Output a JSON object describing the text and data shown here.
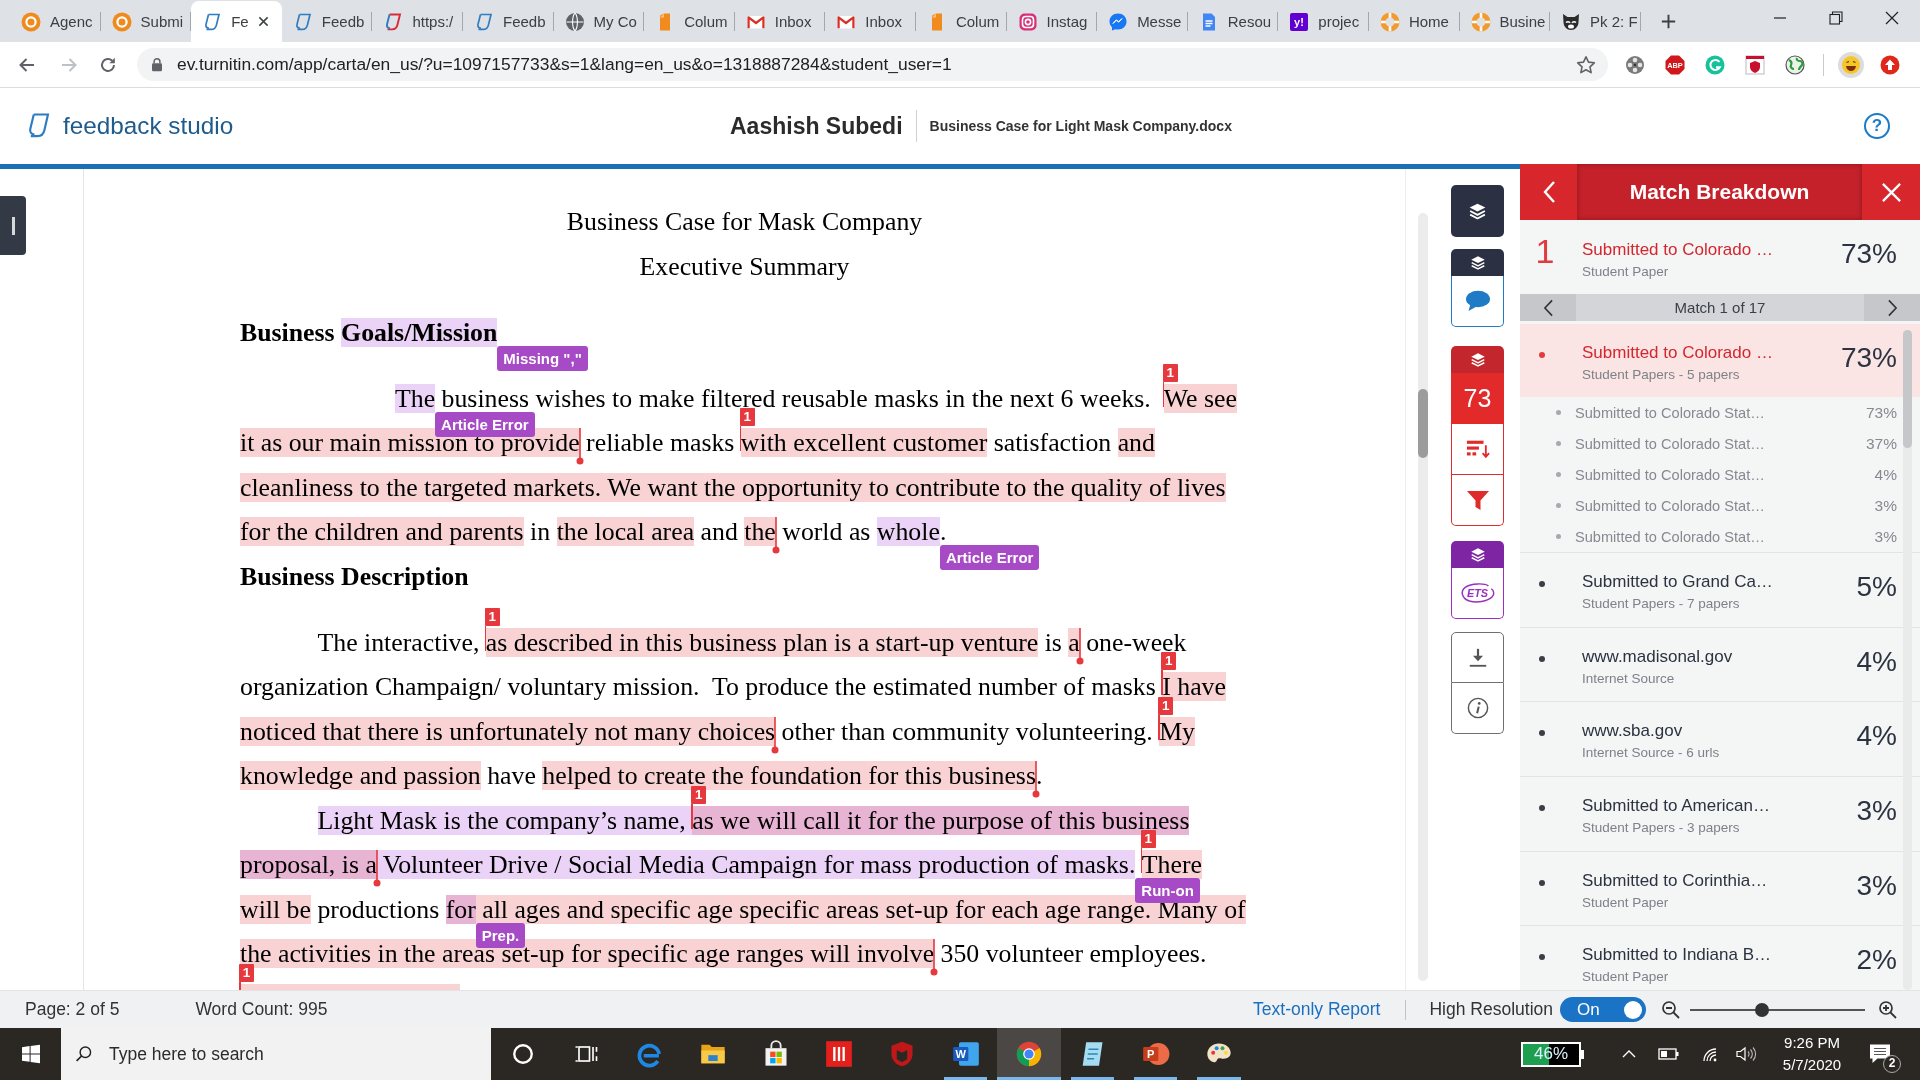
{
  "browser": {
    "tabs": [
      {
        "title": "Agenc",
        "kind": "disc",
        "selected": false
      },
      {
        "title": "Submi",
        "kind": "disc",
        "selected": false
      },
      {
        "title": "Fe",
        "kind": "outline",
        "selected": true
      },
      {
        "title": "Feedb",
        "kind": "outline",
        "selected": false
      },
      {
        "title": "https:/",
        "kind": "outlinealt",
        "selected": false
      },
      {
        "title": "Feedb",
        "kind": "outline",
        "selected": false
      },
      {
        "title": "My Co",
        "kind": "globe",
        "selected": false
      },
      {
        "title": "Colum",
        "kind": "bookmark",
        "selected": false
      },
      {
        "title": "Inbox",
        "kind": "mail",
        "selected": false
      },
      {
        "title": "Inbox",
        "kind": "mail",
        "selected": false
      },
      {
        "title": "Colum",
        "kind": "bookmark",
        "selected": false
      },
      {
        "title": "Instag",
        "kind": "camera",
        "selected": false
      },
      {
        "title": "Messe",
        "kind": "chat",
        "selected": false
      },
      {
        "title": "Resou",
        "kind": "doc",
        "selected": false
      },
      {
        "title": "projec",
        "kind": "letter",
        "glyph": "y!",
        "selected": false
      },
      {
        "title": "Home",
        "kind": "ring",
        "selected": false
      },
      {
        "title": "Busine",
        "kind": "ring",
        "selected": false
      },
      {
        "title": "Pk 2: F",
        "kind": "critter",
        "selected": false
      }
    ],
    "address": "ev.turnitin.com/app/carta/en_us/?u=1097157733&s=1&lang=en_us&o=1318887284&student_user=1",
    "extensions": [
      {
        "kind": "reel"
      },
      {
        "kind": "octagon",
        "glyph": "ABP"
      },
      {
        "kind": "swirl"
      },
      {
        "kind": "shield"
      },
      {
        "kind": "globe"
      },
      {
        "kind": "face"
      },
      {
        "kind": "upload"
      }
    ]
  },
  "header": {
    "brand": "feedback studio",
    "student": "Aashish Subedi",
    "file": "Business Case for Light Mask Company.docx",
    "help": "?"
  },
  "document": {
    "title_lines": [
      "Business Case for Mask Company",
      "Executive Summary"
    ],
    "blocks": [
      {
        "kind": "heading",
        "lines": [
          {
            "segments": [
              {
                "kind": "plain",
                "text": "Business "
              },
              {
                "kind": "taggedgrammar",
                "text": "Goals/Mission"
              }
            ],
            "tags": [
              "Missing \",\""
            ]
          }
        ]
      },
      {
        "kind": "deepparagraph",
        "lines": [
          {
            "segments": [
              {
                "kind": "taggedgrammar",
                "text": "The"
              },
              {
                "kind": "plain",
                "text": " business wishes to make filtered reusable masks in the next 6 weeks.  "
              },
              {
                "kind": "start",
                "text": "1"
              },
              {
                "kind": "match",
                "text": "We see"
              }
            ],
            "tags": [
              "Article Error"
            ]
          },
          {
            "segments": [
              {
                "kind": "match",
                "text": "it as our main mission to provide"
              },
              {
                "kind": "end"
              },
              {
                "kind": "plain",
                "text": " reliable masks "
              },
              {
                "kind": "start",
                "text": "1"
              },
              {
                "kind": "match",
                "text": "with excellent customer"
              },
              {
                "kind": "plain",
                "text": " satisfaction "
              },
              {
                "kind": "match",
                "text": "and"
              }
            ]
          },
          {
            "segments": [
              {
                "kind": "match",
                "text": "cleanliness to the targeted markets. We want the opportunity to contribute to the quality of lives"
              }
            ]
          },
          {
            "segments": [
              {
                "kind": "match",
                "text": "for the children and parents"
              },
              {
                "kind": "plain",
                "text": " in "
              },
              {
                "kind": "match",
                "text": "the local area"
              },
              {
                "kind": "plain",
                "text": " and "
              },
              {
                "kind": "match",
                "text": "the"
              },
              {
                "kind": "end"
              },
              {
                "kind": "plain",
                "text": " world as "
              },
              {
                "kind": "taggedgrammar",
                "text": "whole"
              },
              {
                "kind": "plain",
                "text": "."
              }
            ],
            "tags": [
              "Article Error"
            ]
          }
        ]
      },
      {
        "kind": "heading",
        "lines": [
          {
            "segments": [
              {
                "kind": "plain",
                "text": "Business Description"
              }
            ]
          }
        ]
      },
      {
        "kind": "paragraph",
        "lines": [
          {
            "segments": [
              {
                "kind": "plain",
                "text": "The interactive, "
              },
              {
                "kind": "start",
                "text": "1"
              },
              {
                "kind": "match",
                "text": "as described in this business plan is a start-up venture"
              },
              {
                "kind": "plain",
                "text": " is "
              },
              {
                "kind": "match",
                "text": "a"
              },
              {
                "kind": "end"
              },
              {
                "kind": "plain",
                "text": " one-week"
              }
            ]
          },
          {
            "segments": [
              {
                "kind": "plain",
                "text": "organization Champaign/ voluntary mission.  To produce the estimated number of masks "
              },
              {
                "kind": "start",
                "text": "1"
              },
              {
                "kind": "match",
                "text": "I have"
              }
            ]
          },
          {
            "segments": [
              {
                "kind": "match",
                "text": "noticed that there is unfortunately not many choices"
              },
              {
                "kind": "end"
              },
              {
                "kind": "plain",
                "text": " other than community volunteering. "
              },
              {
                "kind": "start",
                "text": "1"
              },
              {
                "kind": "match",
                "text": "My"
              }
            ]
          },
          {
            "segments": [
              {
                "kind": "match",
                "text": "knowledge and passion"
              },
              {
                "kind": "plain",
                "text": " have "
              },
              {
                "kind": "match",
                "text": "helped to create the foundation for this business"
              },
              {
                "kind": "end"
              },
              {
                "kind": "plain",
                "text": "."
              }
            ]
          }
        ]
      },
      {
        "kind": "paragraph",
        "lines": [
          {
            "segments": [
              {
                "kind": "grammar",
                "text": "Light Mask is the company’s name, "
              },
              {
                "kind": "start",
                "text": "1"
              },
              {
                "kind": "overlap",
                "text": "as we will call it for the purpose of this business"
              }
            ]
          },
          {
            "segments": [
              {
                "kind": "overlap",
                "text": "proposal, is a"
              },
              {
                "kind": "end"
              },
              {
                "kind": "taggedgrammar",
                "text": " Volunteer Drive / Social Media Campaign for mass production of masks."
              },
              {
                "kind": "gap"
              },
              {
                "kind": "start",
                "text": "1"
              },
              {
                "kind": "match",
                "text": "There"
              }
            ],
            "tags": [
              "Run-on"
            ]
          },
          {
            "segments": [
              {
                "kind": "match",
                "text": "will be"
              },
              {
                "kind": "plain",
                "text": " productions "
              },
              {
                "kind": "taggedoverlap",
                "text": "for"
              },
              {
                "kind": "match",
                "text": " all ages and specific age specific areas set-up for each age range. Many of"
              }
            ],
            "tags": [
              "Prep."
            ]
          },
          {
            "segments": [
              {
                "kind": "match",
                "text": "the activities in the areas set-up for specific age ranges will involve"
              },
              {
                "kind": "end"
              },
              {
                "kind": "plain",
                "text": " 350 volunteer employees."
              }
            ]
          },
          {
            "segments": [
              {
                "kind": "start",
                "text": "1"
              },
              {
                "kind": "cut"
              }
            ]
          }
        ]
      }
    ]
  },
  "tools": {
    "similarity_score": "73",
    "grammar_logo": "ETS"
  },
  "match_panel": {
    "title": "Match Breakdown",
    "current": {
      "number": "1",
      "source": "Submitted to Colorado …",
      "type": "Student Paper",
      "percent": "73%"
    },
    "pager": "Match 1 of 17",
    "sources": [
      {
        "source": "Submitted to Colorado …",
        "type": "Student Papers - 5 papers",
        "percent": "73%",
        "selected": true,
        "children": [
          {
            "source": "Submitted to Colorado Stat…",
            "percent": "73%"
          },
          {
            "source": "Submitted to Colorado Stat…",
            "percent": "37%"
          },
          {
            "source": "Submitted to Colorado Stat…",
            "percent": "4%"
          },
          {
            "source": "Submitted to Colorado Stat…",
            "percent": "3%"
          },
          {
            "source": "Submitted to Colorado Stat…",
            "percent": "3%"
          }
        ]
      },
      {
        "source": "Submitted to Grand Ca…",
        "type": "Student Papers - 7 papers",
        "percent": "5%",
        "selected": false
      },
      {
        "source": "www.madisonal.gov",
        "type": "Internet Source",
        "percent": "4%",
        "selected": false
      },
      {
        "source": "www.sba.gov",
        "type": "Internet Source - 6 urls",
        "percent": "4%",
        "selected": false
      },
      {
        "source": "Submitted to American…",
        "type": "Student Papers - 3 papers",
        "percent": "3%",
        "selected": false
      },
      {
        "source": "Submitted to Corinthia…",
        "type": "Student Paper",
        "percent": "3%",
        "selected": false
      },
      {
        "source": "Submitted to Indiana B…",
        "type": "Student Paper",
        "percent": "2%",
        "selected": false
      }
    ]
  },
  "status_bar": {
    "page": "Page: 2 of 5",
    "word_count": "Word Count: 995",
    "text_only_link": "Text-only Report",
    "resolution_label": "High Resolution",
    "resolution_toggle": {
      "label": "On",
      "on": true
    },
    "zoom": {
      "level": 0.41
    }
  },
  "taskbar": {
    "search_placeholder": "Type here to search",
    "apps": [
      {
        "kind": "ring",
        "selected": false,
        "running": false
      },
      {
        "kind": "taskview",
        "selected": false,
        "running": false
      },
      {
        "kind": "edge",
        "selected": false,
        "running": false
      },
      {
        "kind": "folder",
        "selected": false,
        "running": false
      },
      {
        "kind": "store",
        "selected": false,
        "running": false
      },
      {
        "kind": "bars",
        "selected": false,
        "running": false
      },
      {
        "kind": "shield",
        "selected": false,
        "running": false
      },
      {
        "kind": "word",
        "glyph": "W",
        "selected": false,
        "running": true
      },
      {
        "kind": "chrome",
        "selected": true,
        "running": true
      },
      {
        "kind": "pad",
        "selected": false,
        "running": true
      },
      {
        "kind": "slides",
        "glyph": "P",
        "selected": false,
        "running": true
      },
      {
        "kind": "palette",
        "selected": false,
        "running": true
      }
    ],
    "battery_meter": {
      "reading": "46%",
      "level": 0.46
    },
    "clock": {
      "time": "9:26 PM",
      "date": "5/7/2020"
    },
    "notifications": "2"
  }
}
